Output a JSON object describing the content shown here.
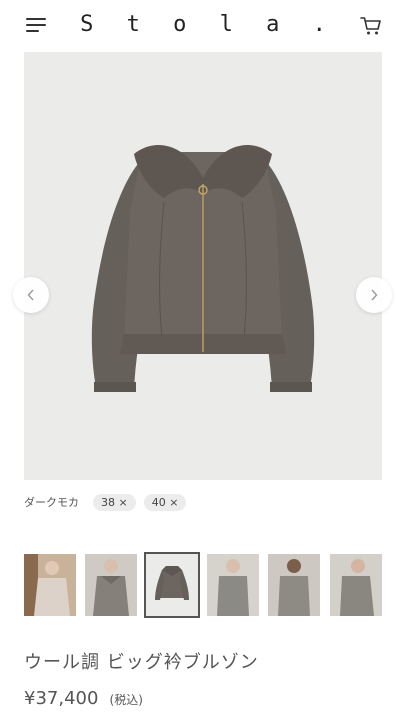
{
  "header": {
    "logo": "S t o l a .",
    "menu_icon": "hamburger-menu-icon",
    "cart_icon": "shopping-cart-icon"
  },
  "gallery": {
    "prev_icon": "chevron-left-icon",
    "next_icon": "chevron-right-icon",
    "main_image": "product-photo-jacket-front",
    "thumbnails": [
      {
        "name": "model-pink-coat-thumb",
        "selected": false
      },
      {
        "name": "model-grey-jacket-thumb",
        "selected": false
      },
      {
        "name": "product-flat-jacket-thumb",
        "selected": true
      },
      {
        "name": "model-grey-jacket-side-thumb",
        "selected": false
      },
      {
        "name": "model-grey-jacket-back-thumb",
        "selected": false
      },
      {
        "name": "model-grey-jacket-turn-thumb",
        "selected": false
      }
    ]
  },
  "variant": {
    "color": "ダークモカ",
    "sizes": [
      "38 ×",
      "40 ×"
    ]
  },
  "product": {
    "name": "ウール調 ビッグ衿ブルゾン",
    "price": "¥37,400",
    "tax": "(税込)"
  },
  "colors": {
    "text": "#333333",
    "image_bg": "#ebebea",
    "jacket": "#6b635d"
  }
}
